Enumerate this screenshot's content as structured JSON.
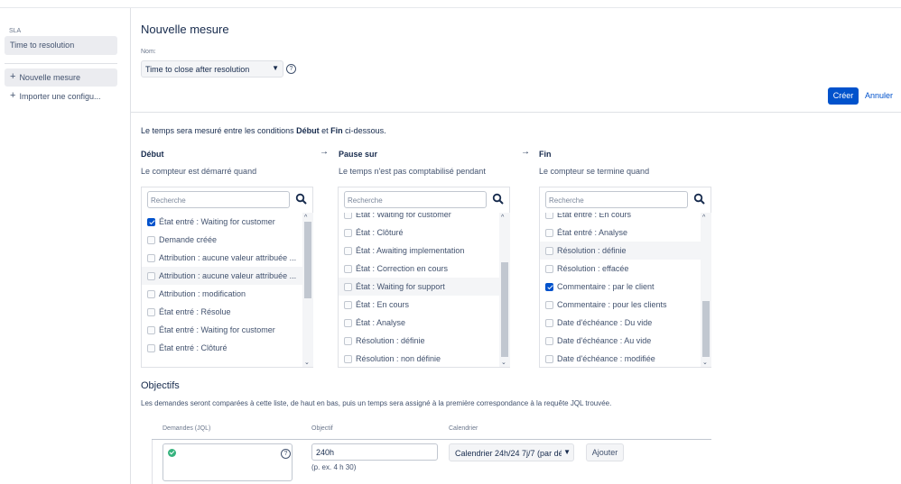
{
  "sidebar": {
    "section_label": "SLA",
    "active_item": "Time to resolution",
    "new_item": "Nouvelle mesure",
    "import_item": "Importer une configu..."
  },
  "header": {
    "title": "Nouvelle mesure",
    "name_label": "Nom:",
    "name_value": "Time to close after resolution",
    "create_label": "Créer",
    "cancel_label": "Annuler"
  },
  "intro": {
    "before": "Le temps sera mesuré entre les conditions ",
    "start_word": "Début",
    "and": " et ",
    "end_word": "Fin",
    "after": " ci-dessous."
  },
  "columns": {
    "start": {
      "title": "Début",
      "subtitle": "Le compteur est démarré quand",
      "search_placeholder": "Recherche",
      "items": [
        {
          "label": "État entré : Waiting for customer",
          "checked": true,
          "hl": false
        },
        {
          "label": "Demande créée",
          "checked": false,
          "hl": false
        },
        {
          "label": "Attribution : aucune valeur attribuée ...",
          "checked": false,
          "hl": false
        },
        {
          "label": "Attribution : aucune valeur attribuée ...",
          "checked": false,
          "hl": true
        },
        {
          "label": "Attribution : modification",
          "checked": false,
          "hl": false
        },
        {
          "label": "État entré : Résolue",
          "checked": false,
          "hl": false
        },
        {
          "label": "État entré : Waiting for customer",
          "checked": false,
          "hl": false
        },
        {
          "label": "État entré : Clôturé",
          "checked": false,
          "hl": false
        }
      ]
    },
    "pause": {
      "title": "Pause sur",
      "subtitle": "Le temps n'est pas comptabilisé pendant",
      "search_placeholder": "Recherche",
      "items": [
        {
          "label": "État : Waiting for customer",
          "checked": false,
          "hl": false
        },
        {
          "label": "État : Clôturé",
          "checked": false,
          "hl": false
        },
        {
          "label": "État : Awaiting implementation",
          "checked": false,
          "hl": false
        },
        {
          "label": "État : Correction en cours",
          "checked": false,
          "hl": false
        },
        {
          "label": "État : Waiting for support",
          "checked": false,
          "hl": true
        },
        {
          "label": "État : En cours",
          "checked": false,
          "hl": false
        },
        {
          "label": "État : Analyse",
          "checked": false,
          "hl": false
        },
        {
          "label": "Résolution : définie",
          "checked": false,
          "hl": false
        },
        {
          "label": "Résolution : non définie",
          "checked": false,
          "hl": false
        }
      ]
    },
    "end": {
      "title": "Fin",
      "subtitle": "Le compteur se termine quand",
      "search_placeholder": "Recherche",
      "items": [
        {
          "label": "État entré : En cours",
          "checked": false,
          "hl": false
        },
        {
          "label": "État entré : Analyse",
          "checked": false,
          "hl": false
        },
        {
          "label": "Résolution : définie",
          "checked": false,
          "hl": true
        },
        {
          "label": "Résolution : effacée",
          "checked": false,
          "hl": false
        },
        {
          "label": "Commentaire : par le client",
          "checked": true,
          "hl": false
        },
        {
          "label": "Commentaire : pour les clients",
          "checked": false,
          "hl": false
        },
        {
          "label": "Date d'échéance : Du vide",
          "checked": false,
          "hl": false
        },
        {
          "label": "Date d'échéance : Au vide",
          "checked": false,
          "hl": false
        },
        {
          "label": "Date d'échéance : modifiée",
          "checked": false,
          "hl": false
        }
      ]
    }
  },
  "objectives": {
    "title": "Objectifs",
    "description": "Les demandes seront comparées à cette liste, de haut en bas, puis un temps sera assigné à la première correspondance à la requête JQL trouvée.",
    "col_jql": "Demandes (JQL)",
    "col_goal": "Objectif",
    "col_calendar": "Calendrier",
    "goal_value": "240h",
    "goal_hint": "(p. ex. 4 h 30)",
    "calendar_value": "Calendrier 24h/24 7j/7 (par dé",
    "add_label": "Ajouter"
  }
}
